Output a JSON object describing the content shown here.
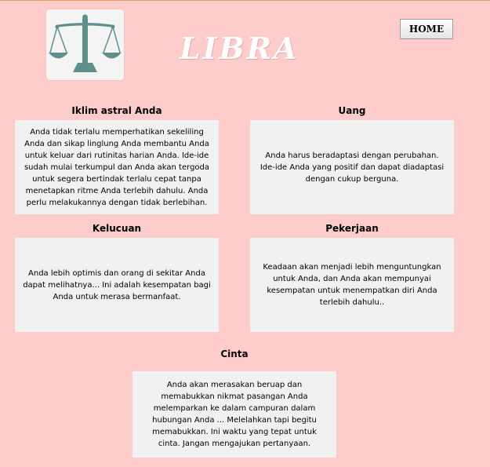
{
  "header": {
    "title": "LIBRA",
    "home_label": "HOME",
    "logo_icon": "libra-scales-icon"
  },
  "sections": {
    "iklim": {
      "heading": "Iklim astral Anda",
      "text": "Anda tidak terlalu memperhatikan sekeliling Anda dan sikap linglung Anda membantu Anda untuk keluar dari rutinitas harian Anda. Ide-ide sudah mulai terkumpul dan Anda akan tergoda untuk segera bertindak terlalu cepat tanpa menetapkan ritme Anda terlebih dahulu. Anda perlu melakukannya dengan tidak berlebihan."
    },
    "uang": {
      "heading": "Uang",
      "text": "Anda harus beradaptasi dengan perubahan. Ide-ide Anda yang positif dan dapat diadaptasi dengan cukup berguna."
    },
    "kelucuan": {
      "heading": "Kelucuan",
      "text": "Anda lebih optimis dan orang di sekitar Anda dapat melihatnya... Ini adalah kesempatan bagi Anda untuk merasa bermanfaat."
    },
    "pekerjaan": {
      "heading": "Pekerjaan",
      "text": "Keadaan akan menjadi lebih menguntungkan untuk Anda, dan Anda akan mempunyai kesempatan untuk menempatkan diri Anda terlebih dahulu.."
    },
    "cinta": {
      "heading": "Cinta",
      "text": "Anda akan merasakan beruap dan memabukkan nikmat pasangan Anda melemparkan ke dalam campuran dalam hubungan Anda ... Melelahkan tapi begitu memabukkan. Ini waktu yang tepat untuk cinta. Jangan mengajukan pertanyaan."
    }
  },
  "colors": {
    "background": "#ffcccc",
    "box": "#f2f0f0",
    "scales": "#5f8f8c"
  }
}
